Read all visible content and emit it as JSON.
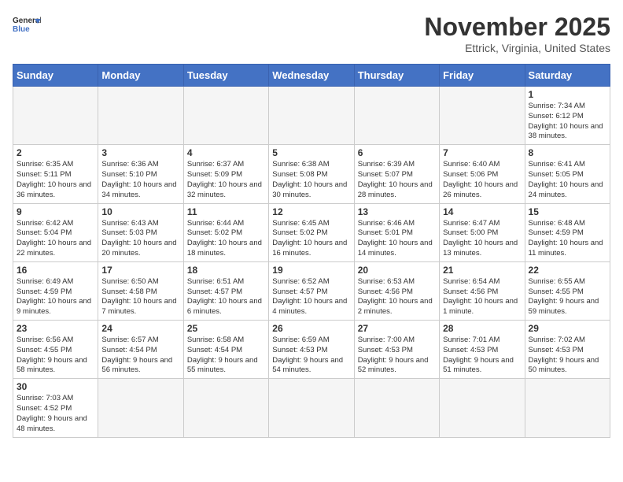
{
  "logo": {
    "text_general": "General",
    "text_blue": "Blue"
  },
  "header": {
    "title": "November 2025",
    "subtitle": "Ettrick, Virginia, United States"
  },
  "weekdays": [
    "Sunday",
    "Monday",
    "Tuesday",
    "Wednesday",
    "Thursday",
    "Friday",
    "Saturday"
  ],
  "weeks": [
    [
      {
        "day": "",
        "info": ""
      },
      {
        "day": "",
        "info": ""
      },
      {
        "day": "",
        "info": ""
      },
      {
        "day": "",
        "info": ""
      },
      {
        "day": "",
        "info": ""
      },
      {
        "day": "",
        "info": ""
      },
      {
        "day": "1",
        "info": "Sunrise: 7:34 AM\nSunset: 6:12 PM\nDaylight: 10 hours and 38 minutes."
      }
    ],
    [
      {
        "day": "2",
        "info": "Sunrise: 6:35 AM\nSunset: 5:11 PM\nDaylight: 10 hours and 36 minutes."
      },
      {
        "day": "3",
        "info": "Sunrise: 6:36 AM\nSunset: 5:10 PM\nDaylight: 10 hours and 34 minutes."
      },
      {
        "day": "4",
        "info": "Sunrise: 6:37 AM\nSunset: 5:09 PM\nDaylight: 10 hours and 32 minutes."
      },
      {
        "day": "5",
        "info": "Sunrise: 6:38 AM\nSunset: 5:08 PM\nDaylight: 10 hours and 30 minutes."
      },
      {
        "day": "6",
        "info": "Sunrise: 6:39 AM\nSunset: 5:07 PM\nDaylight: 10 hours and 28 minutes."
      },
      {
        "day": "7",
        "info": "Sunrise: 6:40 AM\nSunset: 5:06 PM\nDaylight: 10 hours and 26 minutes."
      },
      {
        "day": "8",
        "info": "Sunrise: 6:41 AM\nSunset: 5:05 PM\nDaylight: 10 hours and 24 minutes."
      }
    ],
    [
      {
        "day": "9",
        "info": "Sunrise: 6:42 AM\nSunset: 5:04 PM\nDaylight: 10 hours and 22 minutes."
      },
      {
        "day": "10",
        "info": "Sunrise: 6:43 AM\nSunset: 5:03 PM\nDaylight: 10 hours and 20 minutes."
      },
      {
        "day": "11",
        "info": "Sunrise: 6:44 AM\nSunset: 5:02 PM\nDaylight: 10 hours and 18 minutes."
      },
      {
        "day": "12",
        "info": "Sunrise: 6:45 AM\nSunset: 5:02 PM\nDaylight: 10 hours and 16 minutes."
      },
      {
        "day": "13",
        "info": "Sunrise: 6:46 AM\nSunset: 5:01 PM\nDaylight: 10 hours and 14 minutes."
      },
      {
        "day": "14",
        "info": "Sunrise: 6:47 AM\nSunset: 5:00 PM\nDaylight: 10 hours and 13 minutes."
      },
      {
        "day": "15",
        "info": "Sunrise: 6:48 AM\nSunset: 4:59 PM\nDaylight: 10 hours and 11 minutes."
      }
    ],
    [
      {
        "day": "16",
        "info": "Sunrise: 6:49 AM\nSunset: 4:59 PM\nDaylight: 10 hours and 9 minutes."
      },
      {
        "day": "17",
        "info": "Sunrise: 6:50 AM\nSunset: 4:58 PM\nDaylight: 10 hours and 7 minutes."
      },
      {
        "day": "18",
        "info": "Sunrise: 6:51 AM\nSunset: 4:57 PM\nDaylight: 10 hours and 6 minutes."
      },
      {
        "day": "19",
        "info": "Sunrise: 6:52 AM\nSunset: 4:57 PM\nDaylight: 10 hours and 4 minutes."
      },
      {
        "day": "20",
        "info": "Sunrise: 6:53 AM\nSunset: 4:56 PM\nDaylight: 10 hours and 2 minutes."
      },
      {
        "day": "21",
        "info": "Sunrise: 6:54 AM\nSunset: 4:56 PM\nDaylight: 10 hours and 1 minute."
      },
      {
        "day": "22",
        "info": "Sunrise: 6:55 AM\nSunset: 4:55 PM\nDaylight: 9 hours and 59 minutes."
      }
    ],
    [
      {
        "day": "23",
        "info": "Sunrise: 6:56 AM\nSunset: 4:55 PM\nDaylight: 9 hours and 58 minutes."
      },
      {
        "day": "24",
        "info": "Sunrise: 6:57 AM\nSunset: 4:54 PM\nDaylight: 9 hours and 56 minutes."
      },
      {
        "day": "25",
        "info": "Sunrise: 6:58 AM\nSunset: 4:54 PM\nDaylight: 9 hours and 55 minutes."
      },
      {
        "day": "26",
        "info": "Sunrise: 6:59 AM\nSunset: 4:53 PM\nDaylight: 9 hours and 54 minutes."
      },
      {
        "day": "27",
        "info": "Sunrise: 7:00 AM\nSunset: 4:53 PM\nDaylight: 9 hours and 52 minutes."
      },
      {
        "day": "28",
        "info": "Sunrise: 7:01 AM\nSunset: 4:53 PM\nDaylight: 9 hours and 51 minutes."
      },
      {
        "day": "29",
        "info": "Sunrise: 7:02 AM\nSunset: 4:53 PM\nDaylight: 9 hours and 50 minutes."
      }
    ],
    [
      {
        "day": "30",
        "info": "Sunrise: 7:03 AM\nSunset: 4:52 PM\nDaylight: 9 hours and 48 minutes."
      },
      {
        "day": "",
        "info": ""
      },
      {
        "day": "",
        "info": ""
      },
      {
        "day": "",
        "info": ""
      },
      {
        "day": "",
        "info": ""
      },
      {
        "day": "",
        "info": ""
      },
      {
        "day": "",
        "info": ""
      }
    ]
  ]
}
